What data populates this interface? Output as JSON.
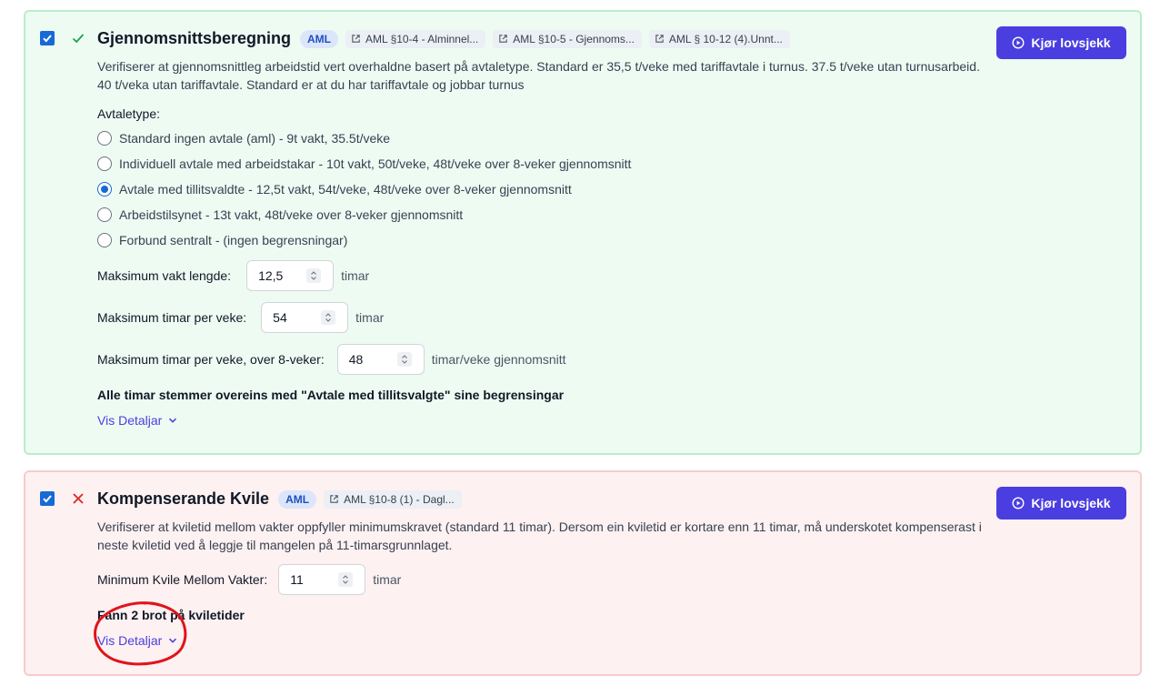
{
  "cards": [
    {
      "title": "Gjennomsnittsberegning",
      "badge": "AML",
      "refs": [
        "AML §10-4 - Alminnel...",
        "AML §10-5 - Gjennoms...",
        "AML § 10-12 (4).Unnt..."
      ],
      "run_label": "Kjør lovsjekk",
      "description": "Verifiserer at gjennomsnittleg arbeidstid vert overhaldne basert på avtaletype. Standard er 35,5 t/veke med tariffavtale i turnus. 37.5 t/veke utan turnusarbeid. 40 t/veka utan tariffavtale. Standard er at du har tariffavtale og jobbar turnus",
      "agreement_label": "Avtaletype:",
      "options": [
        "Standard ingen avtale (aml) - 9t vakt, 35.5t/veke",
        "Individuell avtale med arbeidstakar - 10t vakt, 50t/veke, 48t/veke over 8-veker gjennomsnitt",
        "Avtale med tillitsvaldte - 12,5t vakt, 54t/veke, 48t/veke over 8-veker gjennomsnitt",
        "Arbeidstilsynet - 13t vakt, 48t/veke over 8-veker gjennomsnitt",
        "Forbund sentralt - (ingen begrensningar)"
      ],
      "selected_option": "Avtale med tillitsvaldte - 12,5t vakt, 54t/veke, 48t/veke over 8-veker gjennomsnitt",
      "fields": [
        {
          "label": "Maksimum vakt lengde:",
          "value": "12,5",
          "unit": "timar"
        },
        {
          "label": "Maksimum timar per veke:",
          "value": "54",
          "unit": "timar"
        },
        {
          "label": "Maksimum timar per veke, over 8-veker:",
          "value": "48",
          "unit": "timar/veke gjennomsnitt"
        }
      ],
      "result": "Alle timar stemmer overeins med \"Avtale med tillitsvalgte\" sine begrensingar",
      "details_label": "Vis Detaljar",
      "status": "pass",
      "status_color": "#16a34a"
    },
    {
      "title": "Kompenserande Kvile",
      "badge": "AML",
      "refs": [
        "AML §10-8 (1) - Dagl..."
      ],
      "run_label": "Kjør lovsjekk",
      "description": "Verifiserer at kviletid mellom vakter oppfyller minimumskravet (standard 11 timar). Dersom ein kviletid er kortare enn 11 timar, må underskotet kompenserast i neste kviletid ved å leggje til mangelen på 11-timarsgrunnlaget.",
      "fields": [
        {
          "label": "Minimum Kvile Mellom Vakter:",
          "value": "11",
          "unit": "timar"
        }
      ],
      "result": "Fann 2 brot på kviletider",
      "details_label": "Vis Detaljar",
      "status": "fail",
      "status_color": "#dc2626"
    }
  ],
  "colors": {
    "accent": "#4a3ee0",
    "checkbox": "#1769d6",
    "annotation": "#e0141b"
  }
}
